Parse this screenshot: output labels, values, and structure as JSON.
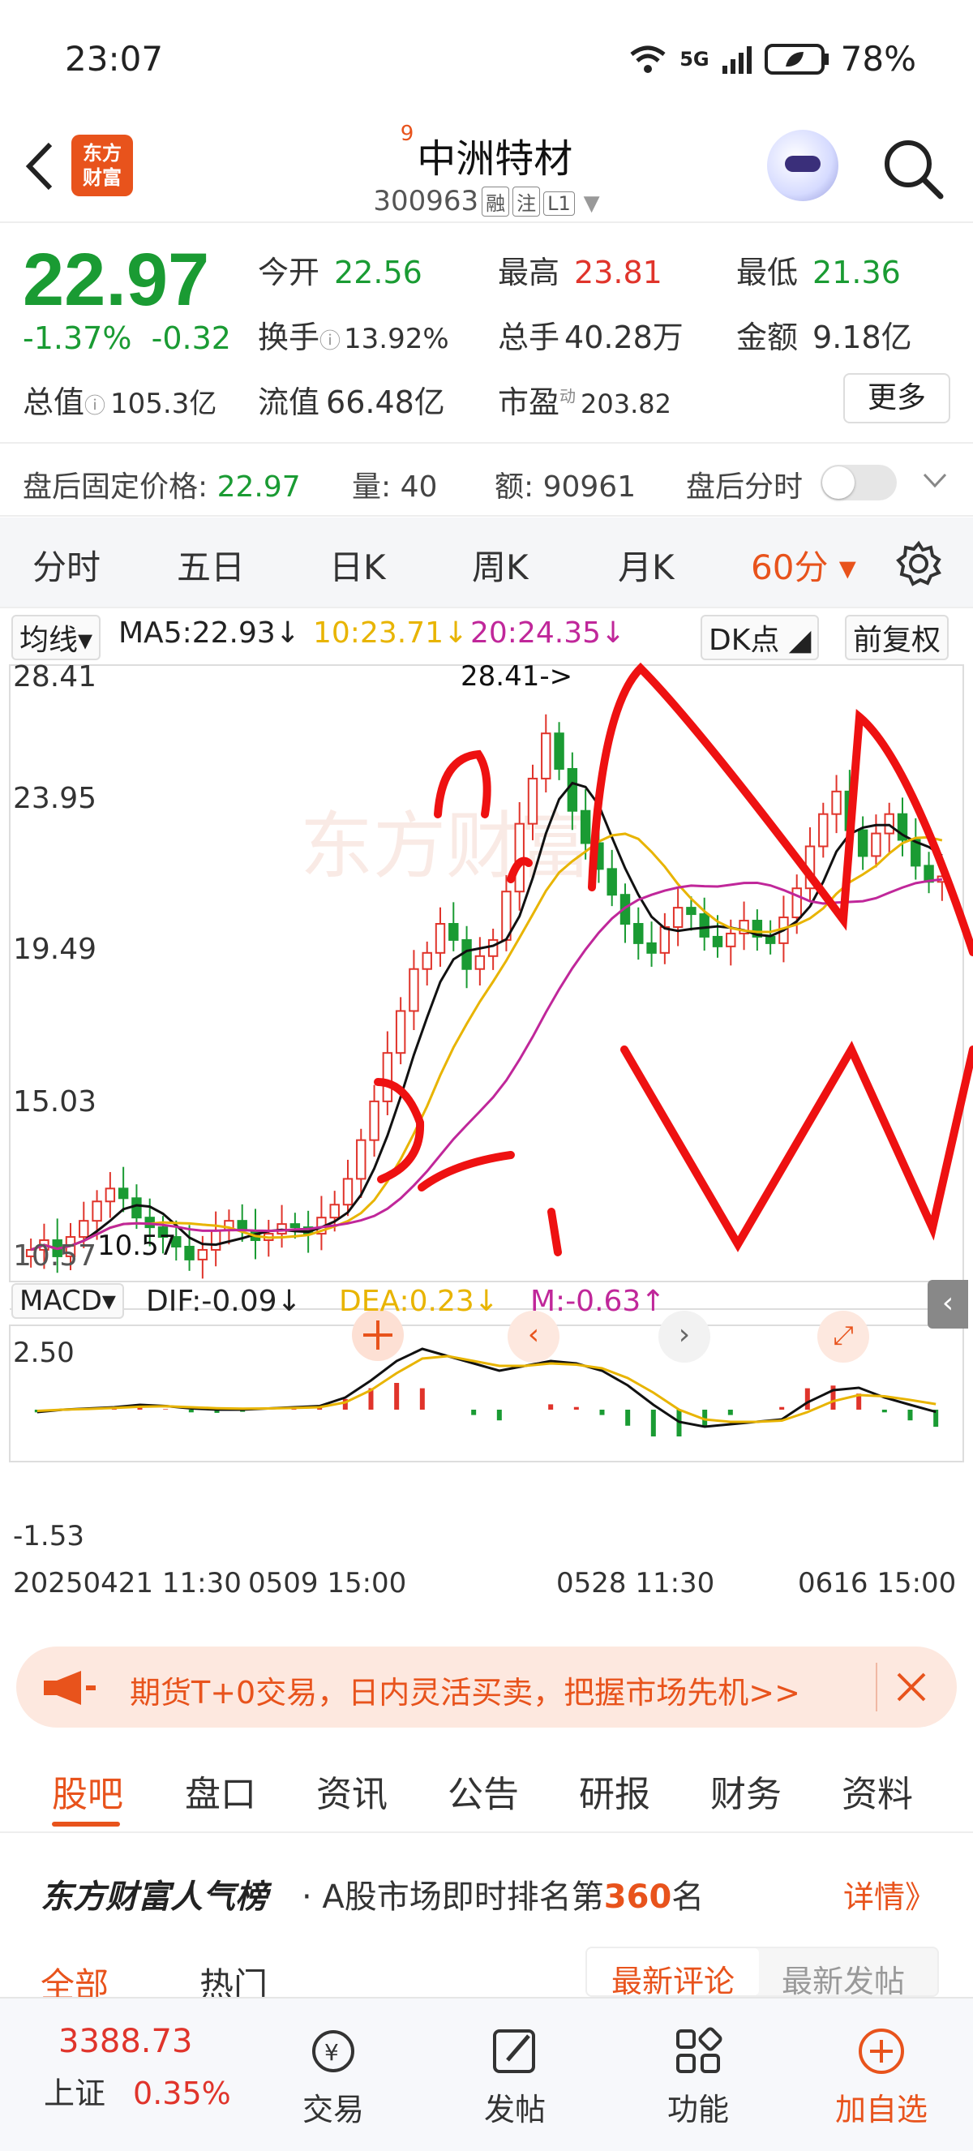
{
  "status": {
    "time": "23:07",
    "battery": "78%",
    "network": "5G"
  },
  "header": {
    "superscript": "9",
    "name": "中洲特材",
    "code": "300963",
    "tags": [
      "融",
      "注",
      "L1"
    ],
    "logo_line1": "东方",
    "logo_line2": "财富"
  },
  "quote": {
    "price": "22.97",
    "change_pct": "-1.37%",
    "change": "-0.32",
    "open_label": "今开",
    "open": "22.56",
    "high_label": "最高",
    "high": "23.81",
    "low_label": "最低",
    "low": "21.36",
    "turnover_label": "换手",
    "turnover": "13.92%",
    "volume_label": "总手",
    "volume": "40.28万",
    "amount_label": "金额",
    "amount": "9.18亿",
    "mcap_label": "总值",
    "mcap": "105.3亿",
    "float_label": "流值",
    "float": "66.48亿",
    "pe_label": "市盈",
    "pe_sup": "动",
    "pe": "203.82",
    "more": "更多"
  },
  "after_hours": {
    "price_label": "盘后固定价格:",
    "price": "22.97",
    "vol_label": "量:",
    "vol": "40",
    "amt_label": "额:",
    "amt": "90961",
    "toggle_label": "盘后分时"
  },
  "chart_tabs": [
    "分时",
    "五日",
    "日K",
    "周K",
    "月K",
    "60分 ▾"
  ],
  "chart_data": {
    "type": "candlestick",
    "ma_legend": {
      "selector": "均线▾",
      "ma5": "MA5:22.93↓",
      "ma10": "10:23.71↓",
      "ma20": "20:24.35↓"
    },
    "dk_label": "DK点",
    "fuquan": "前复权",
    "y_ticks": [
      "28.41",
      "23.95",
      "19.49",
      "15.03",
      "10.57"
    ],
    "high_note": "28.41->",
    "low_note": "10.57",
    "x_ticks": [
      "20250421 11:30",
      "0509 15:00",
      "0528 11:30",
      "0616 15:00"
    ],
    "macd": {
      "label": "MACD▾",
      "dif": "DIF:-0.09↓",
      "dea": "DEA:0.23↓",
      "m": "M:-0.63↑",
      "y_ticks": [
        "2.50",
        "-1.53"
      ]
    },
    "closes": [
      11.4,
      11.7,
      11.2,
      11.8,
      12.3,
      12.9,
      13.3,
      13.0,
      12.4,
      12.1,
      11.8,
      11.5,
      11.1,
      11.4,
      12.0,
      12.3,
      12.0,
      11.7,
      11.9,
      12.2,
      12.1,
      11.9,
      12.4,
      12.8,
      13.6,
      14.8,
      16.0,
      17.5,
      18.8,
      20.1,
      20.6,
      21.5,
      21.0,
      20.1,
      20.5,
      21.0,
      22.5,
      24.6,
      26.0,
      27.4,
      26.3,
      25.0,
      24.0,
      23.2,
      22.4,
      21.5,
      20.9,
      20.6,
      21.4,
      22.0,
      21.8,
      21.1,
      20.8,
      21.2,
      21.6,
      21.1,
      20.9,
      21.7,
      22.6,
      23.9,
      24.9,
      25.6,
      24.4,
      23.6,
      24.3,
      24.9,
      24.1,
      23.3,
      22.8,
      22.97
    ],
    "macd_dif": [
      -0.1,
      0.0,
      0.05,
      0.1,
      0.2,
      0.15,
      0.05,
      0.0,
      0.0,
      0.05,
      0.1,
      0.15,
      0.5,
      1.2,
      2.0,
      2.5,
      2.2,
      1.9,
      1.6,
      1.8,
      2.0,
      1.9,
      1.6,
      1.0,
      0.2,
      -0.5,
      -0.7,
      -0.6,
      -0.5,
      -0.4,
      0.3,
      0.8,
      0.9,
      0.5,
      0.2,
      -0.09
    ],
    "macd_dea": [
      -0.05,
      0.0,
      0.03,
      0.07,
      0.12,
      0.14,
      0.1,
      0.06,
      0.04,
      0.05,
      0.07,
      0.1,
      0.3,
      0.8,
      1.5,
      2.1,
      2.2,
      2.0,
      1.8,
      1.8,
      1.9,
      1.85,
      1.7,
      1.3,
      0.7,
      0.0,
      -0.4,
      -0.5,
      -0.5,
      -0.45,
      -0.1,
      0.35,
      0.6,
      0.55,
      0.4,
      0.23
    ]
  },
  "ad": {
    "text": "期货T+0交易，日内灵活买卖，把握市场先机>>"
  },
  "sub_tabs": [
    "股吧",
    "盘口",
    "资讯",
    "公告",
    "研报",
    "财务",
    "资料"
  ],
  "rank": {
    "brand": "东方财富人气榜",
    "text": "· A股市场即时排名第",
    "num": "360",
    "suffix": "名",
    "detail": "详情》"
  },
  "list_tabs": {
    "all": "全部",
    "hot": "热门",
    "latest_comment": "最新评论",
    "latest_post": "最新发帖"
  },
  "bottom_nav": {
    "index_value": "3388.73",
    "index_name": "上证",
    "index_pct": "0.35%",
    "trade": "交易",
    "post": "发帖",
    "func": "功能",
    "add": "加自选"
  }
}
